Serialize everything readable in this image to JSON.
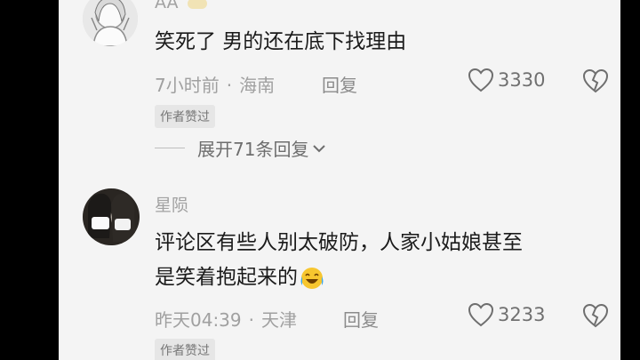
{
  "comments": [
    {
      "username": "AA",
      "text_lines": [
        "笑死了 男的还在底下找理由"
      ],
      "time": "7小时前",
      "location": "海南",
      "reply_label": "回复",
      "likes": "3330",
      "badge": "作者赞过",
      "expand_label": "展开71条回复"
    },
    {
      "username": "星陨",
      "text_lines": [
        "评论区有些人别太破防，人家小姑娘甚至",
        "是笑着抱起来的"
      ],
      "time": "昨天04:39",
      "location": "天津",
      "reply_label": "回复",
      "likes": "3233",
      "badge": "作者赞过"
    }
  ],
  "colors": {
    "background": "#f4f4f4",
    "text": "#1b1b1b",
    "muted": "#a0a0a0"
  },
  "icons": [
    "heart-outline-icon",
    "broken-heart-icon",
    "chevron-down-icon",
    "laughing-emoji-icon"
  ]
}
